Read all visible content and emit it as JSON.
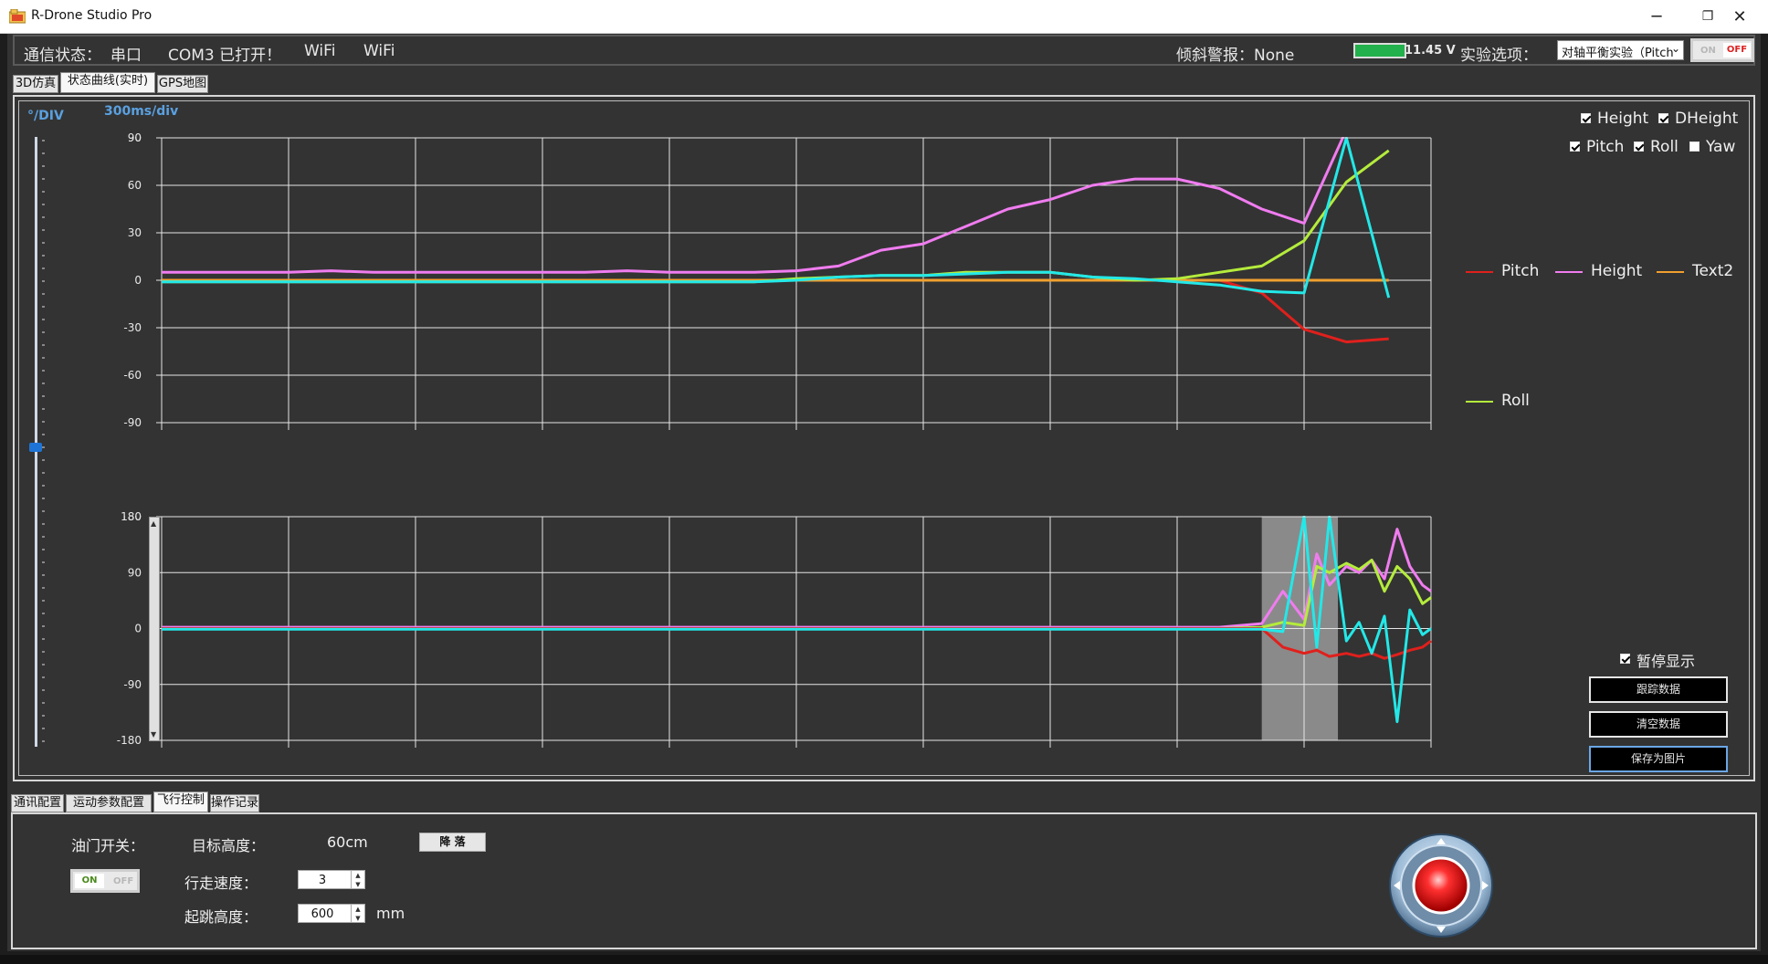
{
  "window": {
    "title": "R-Drone Studio  Pro",
    "min_glyph": "─",
    "max_glyph": "❐",
    "close_glyph": "✕"
  },
  "topbar": {
    "comm_status_label": "通信状态：",
    "serial_label": "串口",
    "com_status": "COM3 已打开！",
    "wifi_1": "WiFi",
    "wifi_2": "WiFi",
    "tilt_alarm_label": "倾斜警报：None",
    "voltage": "11.45 V",
    "experiment_label": "实验选项：",
    "experiment_value": "对轴平衡实验（Pitch",
    "toggle_on": "ON",
    "toggle_off": "OFF"
  },
  "view_tabs": [
    "3D仿真",
    "状态曲线(实时)",
    "GPS地图"
  ],
  "view_tabs_active": 1,
  "chart_panel": {
    "y_unit": "°/DIV",
    "time_div": "300ms/div",
    "checkboxes": [
      {
        "label": "Height",
        "checked": true
      },
      {
        "label": "DHeight",
        "checked": true
      },
      {
        "label": "Pitch",
        "checked": true
      },
      {
        "label": "Roll",
        "checked": true
      },
      {
        "label": "Yaw",
        "checked": false
      }
    ],
    "legend": [
      {
        "label": "Pitch",
        "color": "#e0201c"
      },
      {
        "label": "Height",
        "color": "#f07cf0"
      },
      {
        "label": "Text2",
        "color": "#f0a030"
      },
      {
        "label": "Roll",
        "color": "#b4ec3c"
      }
    ],
    "pause_label": "暂停显示",
    "pause_checked": true,
    "buttons": [
      "跟踪数据",
      "清空数据",
      "保存为图片"
    ]
  },
  "chart_data": [
    {
      "type": "line",
      "ylim": [
        -90,
        90
      ],
      "yticks": [
        "90",
        "60",
        "30",
        "0",
        "-30",
        "-60",
        "-90"
      ],
      "x": [
        0,
        1,
        2,
        3,
        4,
        5,
        6,
        7,
        8,
        9,
        10,
        11,
        12,
        13,
        14,
        15,
        16,
        17,
        18,
        19,
        20,
        21,
        22,
        23,
        24,
        25,
        26,
        27,
        28,
        29,
        30
      ],
      "series": [
        {
          "name": "Height",
          "color": "#f07cf0",
          "values": [
            5,
            5,
            5,
            5,
            6,
            5,
            5,
            5,
            5,
            5,
            5,
            6,
            5,
            5,
            5,
            6,
            9,
            19,
            23,
            34,
            45,
            51,
            60,
            64,
            64,
            58,
            45,
            36,
            95,
            null,
            null
          ]
        },
        {
          "name": "Pitch",
          "color": "#e0201c",
          "values": [
            0,
            0,
            0,
            0,
            0,
            0,
            0,
            0,
            0,
            0,
            0,
            0,
            0,
            0,
            0,
            0,
            0,
            0,
            0,
            0,
            0,
            0,
            0,
            0,
            0,
            0,
            -8,
            -31,
            -39,
            -37,
            null
          ]
        },
        {
          "name": "Text2",
          "color": "#f0a030",
          "values": [
            0,
            0,
            0,
            0,
            0,
            0,
            0,
            0,
            0,
            0,
            0,
            0,
            0,
            0,
            0,
            0,
            0,
            0,
            0,
            0,
            0,
            0,
            0,
            0,
            0,
            0,
            0,
            0,
            0,
            0,
            null
          ]
        },
        {
          "name": "Roll",
          "color": "#b4ec3c",
          "values": [
            -1,
            -1,
            -1,
            -1,
            -1,
            -1,
            -1,
            -1,
            -1,
            -1,
            -1,
            -1,
            -1,
            -1,
            -1,
            1,
            2,
            3,
            3,
            5,
            5,
            5,
            2,
            0,
            1,
            5,
            9,
            25,
            62,
            82,
            null
          ]
        },
        {
          "name": "Cyan",
          "color": "#23e8e8",
          "values": [
            -1,
            -1,
            -1,
            -1,
            -1,
            -1,
            -1,
            -1,
            -1,
            -1,
            -1,
            -1,
            -1,
            -1,
            -1,
            0,
            2,
            3,
            3,
            4,
            5,
            5,
            2,
            1,
            -1,
            -3,
            -7,
            -8,
            90,
            -11,
            null
          ]
        }
      ]
    },
    {
      "type": "line",
      "ylim": [
        -180,
        180
      ],
      "yticks": [
        "180",
        "90",
        "0",
        "-90",
        "-180"
      ],
      "highlight_range": [
        26.0,
        27.8
      ],
      "x": [
        0,
        1,
        2,
        3,
        4,
        5,
        6,
        7,
        8,
        9,
        10,
        11,
        12,
        13,
        14,
        15,
        16,
        17,
        18,
        19,
        20,
        21,
        22,
        23,
        24,
        25,
        26,
        26.5,
        27,
        27.3,
        27.6,
        28,
        28.3,
        28.6,
        28.9,
        29.2,
        29.5,
        29.8,
        30
      ],
      "series": [
        {
          "name": "Height",
          "color": "#f07cf0",
          "values": [
            2,
            2,
            2,
            2,
            2,
            2,
            2,
            2,
            2,
            2,
            2,
            2,
            2,
            2,
            2,
            2,
            2,
            2,
            2,
            2,
            2,
            2,
            2,
            2,
            2,
            2,
            8,
            60,
            15,
            120,
            70,
            100,
            90,
            110,
            80,
            160,
            100,
            70,
            60
          ]
        },
        {
          "name": "Roll",
          "color": "#b4ec3c",
          "values": [
            0,
            0,
            0,
            0,
            0,
            0,
            0,
            0,
            0,
            0,
            0,
            0,
            0,
            0,
            0,
            0,
            0,
            0,
            0,
            0,
            0,
            0,
            0,
            0,
            0,
            0,
            2,
            10,
            5,
            100,
            90,
            105,
            95,
            110,
            60,
            100,
            80,
            40,
            50
          ]
        },
        {
          "name": "Pitch",
          "color": "#e0201c",
          "values": [
            0,
            0,
            0,
            0,
            0,
            0,
            0,
            0,
            0,
            0,
            0,
            0,
            0,
            0,
            0,
            0,
            0,
            0,
            0,
            0,
            0,
            0,
            0,
            0,
            0,
            0,
            0,
            -30,
            -40,
            -35,
            -45,
            -40,
            -45,
            -40,
            -48,
            -42,
            -35,
            -30,
            -20
          ]
        },
        {
          "name": "Cyan",
          "color": "#23e8e8",
          "values": [
            -1,
            -1,
            -1,
            -1,
            -1,
            -1,
            -1,
            -1,
            -1,
            -1,
            -1,
            -1,
            -1,
            -1,
            -1,
            -1,
            -1,
            -1,
            -1,
            -1,
            -1,
            -1,
            -1,
            -1,
            -1,
            -1,
            -1,
            -5,
            180,
            -30,
            180,
            -20,
            10,
            -40,
            20,
            -150,
            30,
            -10,
            0
          ]
        }
      ]
    }
  ],
  "bottom_tabs": [
    "通讯配置",
    "运动参数配置",
    "飞行控制",
    "操作记录"
  ],
  "bottom_tabs_active": 2,
  "flight": {
    "throttle_label": "油门开关：",
    "toggle_on": "ON",
    "toggle_off": "OFF",
    "target_height_label": "目标高度：",
    "target_height_value": "60cm",
    "land_button": "降 落",
    "speed_label": "行走速度：",
    "speed_value": "3",
    "takeoff_label": "起跳高度：",
    "takeoff_value": "600",
    "takeoff_unit": "mm"
  }
}
